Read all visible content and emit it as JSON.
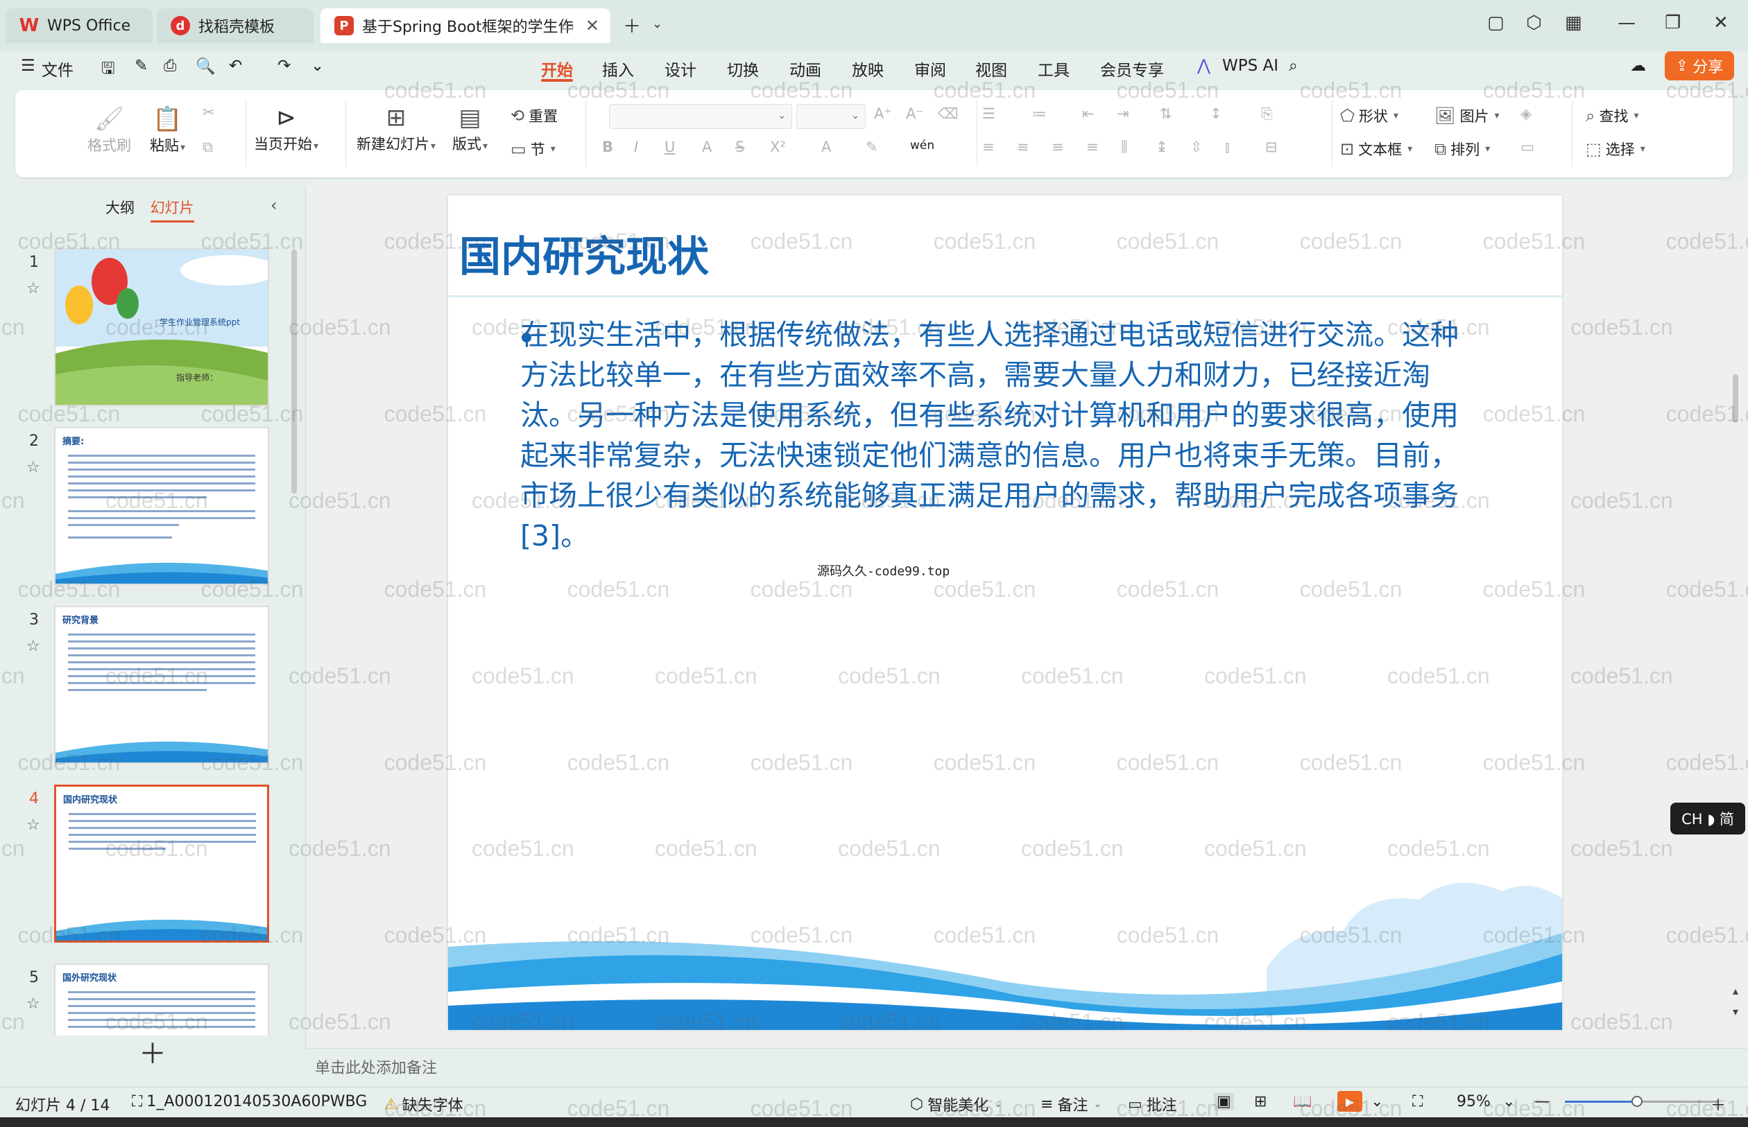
{
  "tabs": {
    "wps": "WPS Office",
    "template": "找稻壳模板",
    "document": "基于Spring Boot框架的学生作"
  },
  "menu": {
    "file": "文件",
    "items": [
      "开始",
      "插入",
      "设计",
      "切换",
      "动画",
      "放映",
      "审阅",
      "视图",
      "工具",
      "会员专享"
    ],
    "active": "开始",
    "wps_ai": "WPS AI",
    "share": "分享"
  },
  "ribbon": {
    "format_painter": "格式刷",
    "paste": "粘贴",
    "play_from_current": "当页开始",
    "new_slide": "新建幻灯片",
    "layout": "版式",
    "reset": "重置",
    "section": "节",
    "shape": "形状",
    "picture": "图片",
    "find": "查找",
    "textbox": "文本框",
    "arrange": "排列",
    "select": "选择"
  },
  "panel": {
    "tab_outline": "大纲",
    "tab_slides": "幻灯片",
    "active_tab": "幻灯片"
  },
  "thumbnails": [
    {
      "num": "1",
      "title": "学生作业管理系统ppt",
      "subtitle": "指导老师："
    },
    {
      "num": "2",
      "title": "摘要:"
    },
    {
      "num": "3",
      "title": "研究背景"
    },
    {
      "num": "4",
      "title": "国内研究现状"
    },
    {
      "num": "5",
      "title": "国外研究现状"
    }
  ],
  "current_slide_index": 4,
  "slide": {
    "title": "国内研究现状",
    "bullet": "在现实生活中，根据传统做法，有些人选择通过电话或短信进行交流。这种方法比较单一，在有些方面效率不高，需要大量人力和财力，已经接近淘汰。另一种方法是使用系统，但有些系统对计算机和用户的要求很高，使用起来非常复杂，无法快速锁定他们满意的信息。用户也将束手无策。目前，市场上很少有类似的系统能够真正满足用户的需求，帮助用户完成各项事务[3]。",
    "caption": "源码久久-code99.top"
  },
  "notes_placeholder": "单击此处添加备注",
  "status": {
    "slide_counter": "幻灯片 4 / 14",
    "layout_name": "1_A000120140530A60PWBG",
    "missing_font": "缺失字体",
    "smart_beautify": "智能美化",
    "notes": "备注",
    "comments": "批注",
    "zoom": "95%"
  },
  "ime": "CH ◗ 简",
  "watermark": "code51.cn",
  "colors": {
    "accent": "#e2522b",
    "share_bg": "#f06a24",
    "slide_blue": "#1565b3"
  }
}
